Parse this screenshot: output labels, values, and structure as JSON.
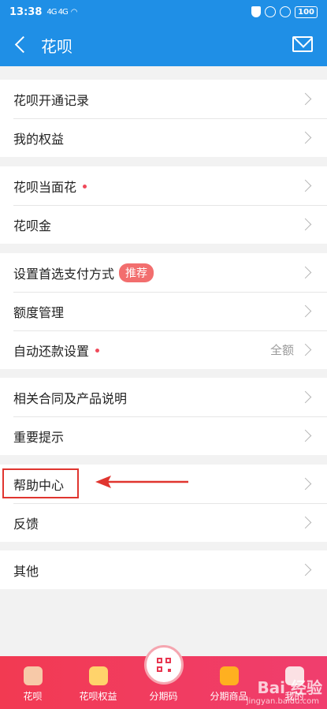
{
  "status_bar": {
    "time": "13:38",
    "signal": "4G 4G",
    "battery": "100"
  },
  "header": {
    "title": "花呗"
  },
  "groups": [
    {
      "items": [
        {
          "label": "花呗开通记录"
        },
        {
          "label": "我的权益"
        }
      ]
    },
    {
      "items": [
        {
          "label": "花呗当面花",
          "dot": true
        },
        {
          "label": "花呗金"
        }
      ]
    },
    {
      "items": [
        {
          "label": "设置首选支付方式",
          "badge": "推荐"
        },
        {
          "label": "额度管理"
        },
        {
          "label": "自动还款设置",
          "dot": true,
          "value": "全额"
        }
      ]
    },
    {
      "items": [
        {
          "label": "相关合同及产品说明"
        },
        {
          "label": "重要提示"
        }
      ]
    },
    {
      "items": [
        {
          "label": "帮助中心"
        },
        {
          "label": "反馈"
        }
      ]
    },
    {
      "items": [
        {
          "label": "其他"
        }
      ]
    }
  ],
  "tabbar": {
    "tabs": [
      {
        "label": "花呗"
      },
      {
        "label": "花呗权益"
      },
      {
        "label": "分期码"
      },
      {
        "label": "分期商品"
      },
      {
        "label": "我的"
      }
    ]
  },
  "watermark": {
    "text": "Bai 经验",
    "sub": "jingyan.baidu.com"
  },
  "colors": {
    "accent": "#1f8fe6",
    "tabbar": "#f23a52",
    "highlight": "#e0352f"
  }
}
